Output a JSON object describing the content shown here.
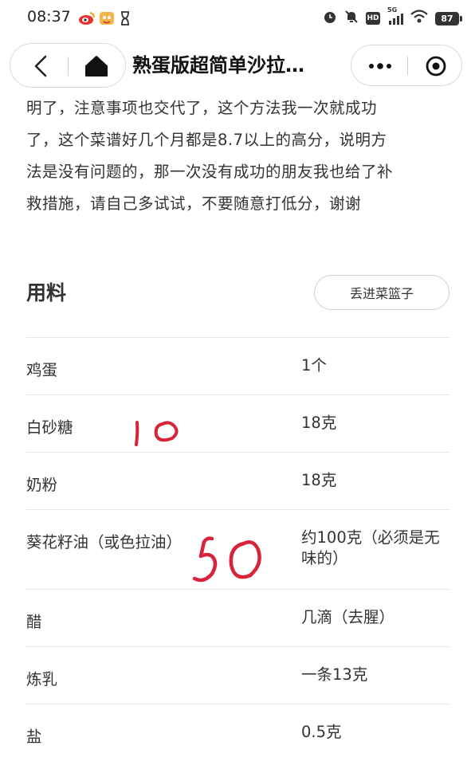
{
  "status_bar": {
    "time": "08:37",
    "signal_label": "5G",
    "hd_label": "HD",
    "battery": "87",
    "icons": [
      "weibo-icon",
      "app-notification-icon",
      "hourglass-icon",
      "alarm-icon",
      "mute-bell-icon",
      "hd-icon",
      "signal-icon",
      "wifi-icon",
      "battery-icon"
    ]
  },
  "nav": {
    "title": "熟蛋版超简单沙拉…",
    "back_icon": "back-arrow-icon",
    "home_icon": "home-icon",
    "more_icon": "more-dots-icon",
    "close_icon": "miniprogram-close-icon"
  },
  "description": {
    "lines": [
      "明了，注意事项也交代了，这个方法我一次就成功",
      "了，这个菜谱好几个月都是8.7以上的高分，说明方",
      "法是没有问题的，那一次没有成功的朋友我也给了补",
      "救措施，请自己多试试，不要随意打低分，谢谢"
    ]
  },
  "ingredients": {
    "title": "用料",
    "basket_button": "丢进菜篮子",
    "items": [
      {
        "name": "鸡蛋",
        "amount": "1个"
      },
      {
        "name": "白砂糖",
        "amount": "18克"
      },
      {
        "name": "奶粉",
        "amount": "18克"
      },
      {
        "name": "葵花籽油（或色拉油）",
        "amount": "约100克（必须是无味的）"
      },
      {
        "name": "醋",
        "amount": "几滴（去腥）"
      },
      {
        "name": "炼乳",
        "amount": "一条13克"
      },
      {
        "name": "盐",
        "amount": "0.5克"
      }
    ]
  },
  "annotations": {
    "handwritten_sugar": "10",
    "handwritten_oil": "50",
    "ink_color": "#d8243a"
  }
}
